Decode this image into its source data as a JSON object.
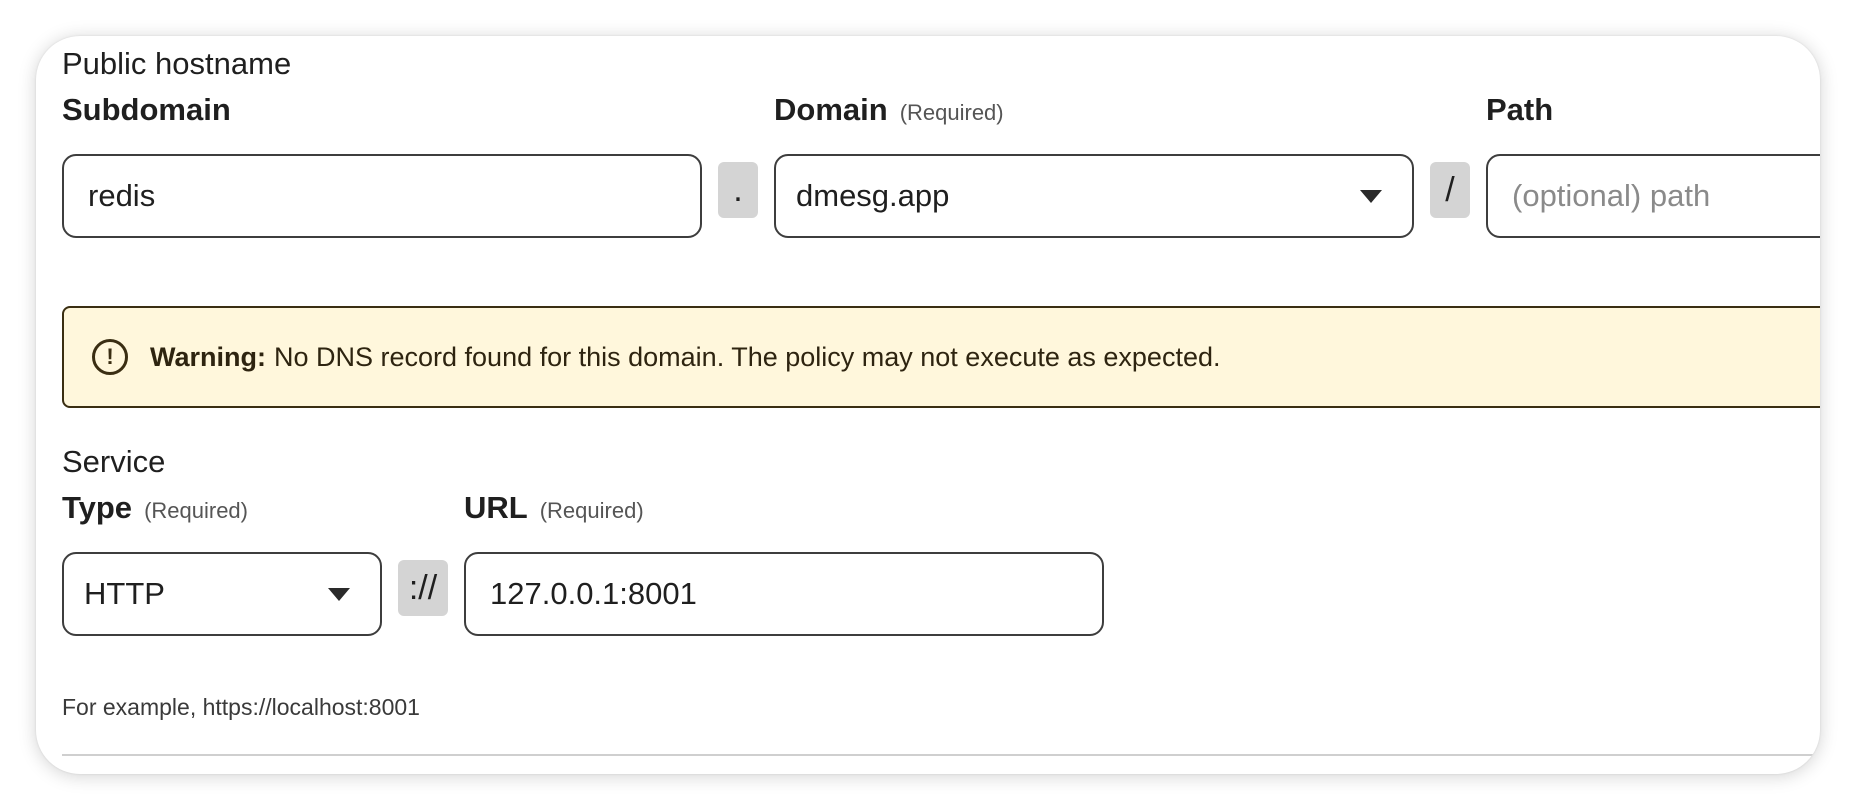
{
  "public_hostname": {
    "section_title": "Public hostname",
    "subdomain": {
      "label": "Subdomain",
      "value": "redis"
    },
    "dot_separator": ".",
    "domain": {
      "label": "Domain",
      "required": "(Required)",
      "value": "dmesg.app"
    },
    "slash_separator": "/",
    "path": {
      "label": "Path",
      "placeholder": "(optional) path"
    }
  },
  "warning": {
    "icon": "exclamation-circle-icon",
    "title": "Warning:",
    "message": "No DNS record found for this domain. The policy may not execute as expected.",
    "background_color": "#fff7dc"
  },
  "service": {
    "section_title": "Service",
    "type": {
      "label": "Type",
      "required": "(Required)",
      "value": "HTTP"
    },
    "scheme_separator": "://",
    "url": {
      "label": "URL",
      "required": "(Required)",
      "value": "127.0.0.1:8001"
    },
    "hint": "For example, https://localhost:8001"
  }
}
